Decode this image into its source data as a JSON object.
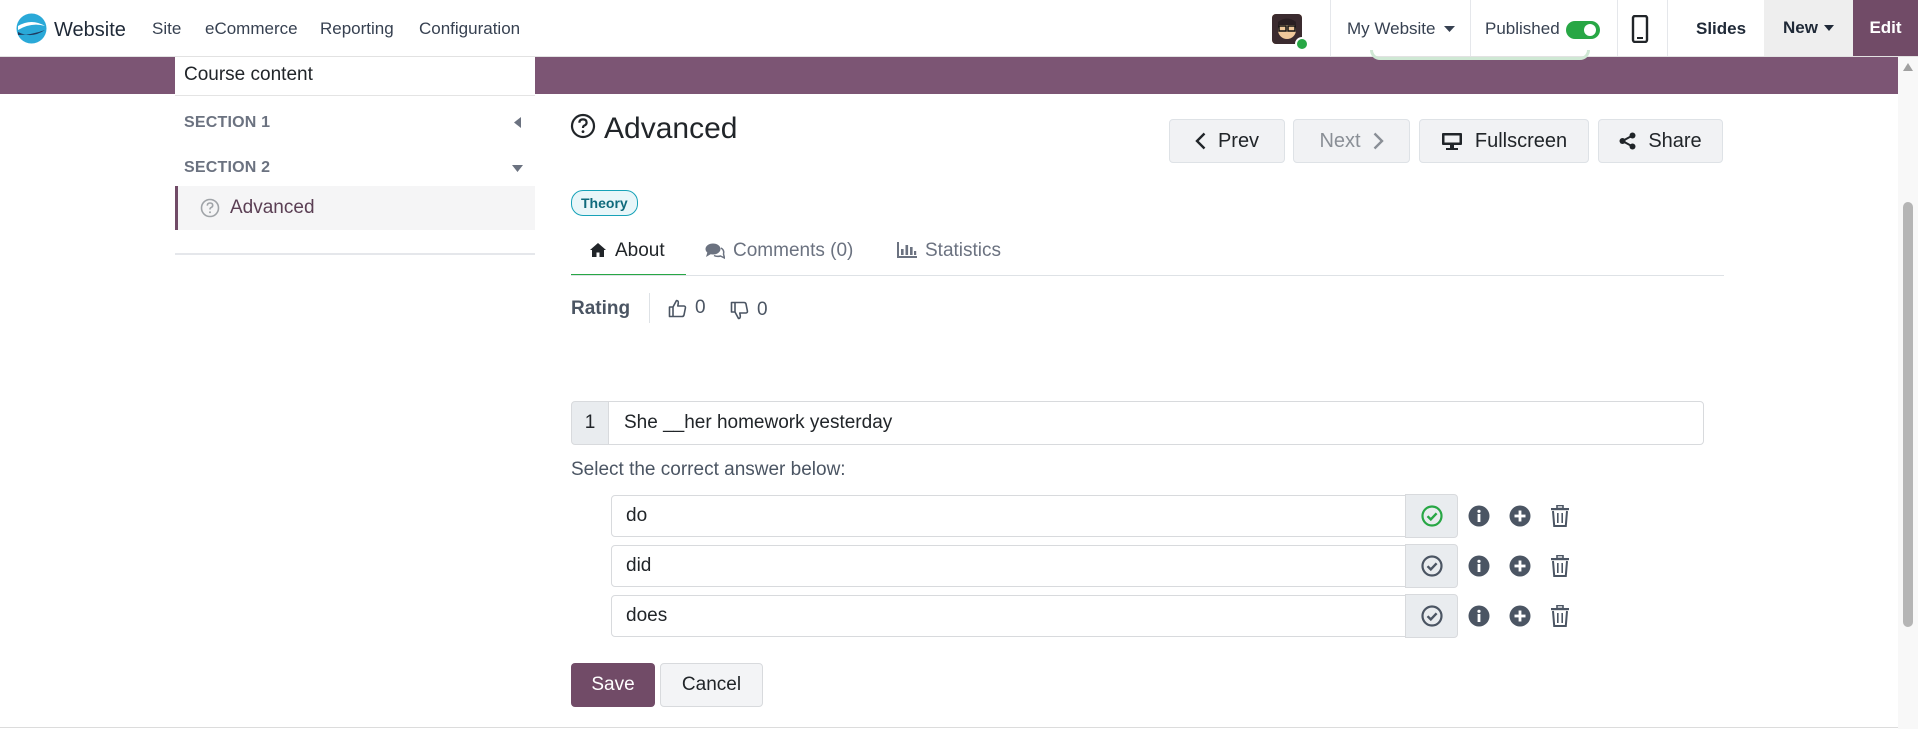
{
  "topbar": {
    "app_name": "Website",
    "menu": [
      "Site",
      "eCommerce",
      "Reporting",
      "Configuration"
    ],
    "website_selector": "My Website",
    "published_label": "Published",
    "published": true,
    "slides_label": "Slides",
    "new_label": "New",
    "edit_label": "Edit"
  },
  "sidebar": {
    "title": "Course content",
    "section1": "SECTION 1",
    "section2": "SECTION 2",
    "active_item": "Advanced"
  },
  "slide": {
    "title": "Advanced",
    "badge": "Theory",
    "prev_label": "Prev",
    "next_label": "Next",
    "fullscreen_label": "Fullscreen",
    "share_label": "Share"
  },
  "tabs": [
    "About",
    "Comments (0)",
    "Statistics"
  ],
  "rating": {
    "label": "Rating",
    "likes": "0",
    "dislikes": "0"
  },
  "question": {
    "number": "1",
    "text": "She __her homework yesterday",
    "instruction": "Select the correct answer below:",
    "answers": [
      {
        "text": "do",
        "correct": true
      },
      {
        "text": "did",
        "correct": false
      },
      {
        "text": "does",
        "correct": false
      }
    ]
  },
  "form": {
    "save_label": "Save",
    "cancel_label": "Cancel"
  },
  "colors": {
    "brand": "#714b67",
    "band": "#7c5574",
    "success": "#28a745",
    "toggle": "#28a745"
  }
}
